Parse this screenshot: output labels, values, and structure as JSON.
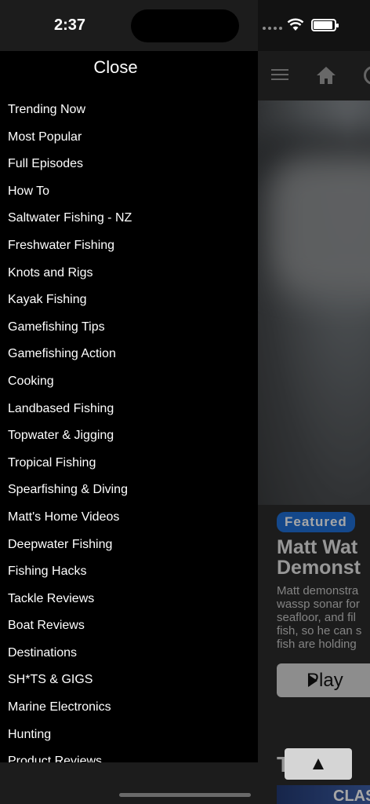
{
  "status_bar": {
    "time": "2:37"
  },
  "drawer": {
    "close_label": "Close",
    "menu_items": [
      "Trending Now",
      "Most Popular",
      "Full Episodes",
      "How To",
      "Saltwater Fishing - NZ",
      "Freshwater Fishing",
      "Knots and Rigs",
      "Kayak Fishing",
      "Gamefishing Tips",
      "Gamefishing Action",
      "Cooking",
      "Landbased Fishing",
      "Topwater & Jigging",
      "Tropical Fishing",
      "Spearfishing & Diving",
      "Matt's Home Videos",
      "Deepwater Fishing",
      "Fishing Hacks",
      "Tackle Reviews",
      "Boat Reviews",
      "Destinations",
      "SH*TS & GIGS",
      "Marine Electronics",
      "Hunting",
      "Product Reviews"
    ]
  },
  "background": {
    "featured_badge": "Featured",
    "featured_title_line1": "Matt Wat",
    "featured_title_line2": "Demonst",
    "featured_desc": [
      "Matt demonstra",
      "wassp sonar for",
      "seafloor, and fil",
      "fish, so he can s",
      "fish are holding"
    ],
    "play_label": "Play",
    "section_title": "T  n",
    "thumb_label": "CLAS",
    "scroll_top_label": "▲"
  },
  "colors": {
    "accent": "#1f6fd6",
    "drawer_bg": "#000000",
    "status_bg": "#1c1c1c"
  }
}
